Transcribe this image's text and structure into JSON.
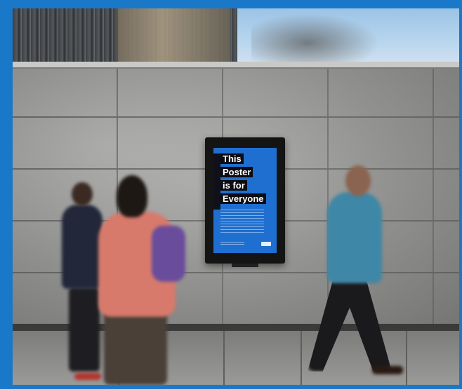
{
  "photo": {
    "subject": "outdoor-poster-display",
    "poster": {
      "headline_lines": [
        "This",
        "Poster",
        "is for",
        "Everyone"
      ],
      "background_color": "#1f6fd0",
      "headline_bg_color": "#0c0c12",
      "headline_text_color": "#ffffff"
    }
  },
  "frame": {
    "border_color": "#1a78c9"
  }
}
